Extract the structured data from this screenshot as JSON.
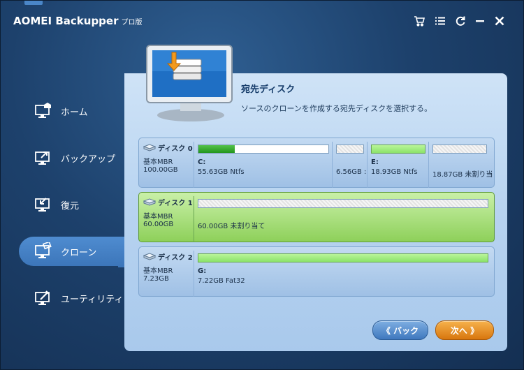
{
  "app": {
    "title": "AOMEI Backupper",
    "edition": "プロ版"
  },
  "titlebar": {
    "icons": [
      "cart-icon",
      "menu-list-icon",
      "refresh-icon",
      "minimize-icon",
      "close-icon"
    ]
  },
  "sidebar": {
    "items": [
      {
        "label": "ホーム",
        "icon": "home-icon",
        "active": false
      },
      {
        "label": "バックアップ",
        "icon": "backup-icon",
        "active": false
      },
      {
        "label": "復元",
        "icon": "restore-icon",
        "active": false
      },
      {
        "label": "クローン",
        "icon": "clone-icon",
        "active": true
      },
      {
        "label": "ユーティリティ",
        "icon": "tools-icon",
        "active": false
      }
    ]
  },
  "panel": {
    "heading": "宛先ディスク",
    "description": "ソースのクローンを作成する宛先ディスクを選択する。"
  },
  "disks": [
    {
      "name": "ディスク 0",
      "type": "基本MBR",
      "size": "100.00GB",
      "selected": false,
      "partitions": [
        {
          "label": "C:",
          "size": "55.63GB Ntfs",
          "used_fraction": 0.28,
          "style": "used"
        },
        {
          "label": "",
          "size": "6.56GB :",
          "used_fraction": 0,
          "style": "hatch"
        },
        {
          "label": "E:",
          "size": "18.93GB Ntfs",
          "used_fraction": 1.0,
          "style": "lime"
        },
        {
          "label": "",
          "size": "18.87GB 未割り当",
          "used_fraction": 0,
          "style": "hatch"
        }
      ]
    },
    {
      "name": "ディスク 1",
      "type": "基本MBR",
      "size": "60.00GB",
      "selected": true,
      "partitions": [
        {
          "label": "",
          "size": "60.00GB 未割り当て",
          "used_fraction": 0,
          "style": "hatch"
        }
      ]
    },
    {
      "name": "ディスク 2",
      "type": "基本MBR",
      "size": "7.23GB",
      "selected": false,
      "partitions": [
        {
          "label": "G:",
          "size": "7.22GB Fat32",
          "used_fraction": 1.0,
          "style": "lime"
        }
      ]
    }
  ],
  "buttons": {
    "back": "《 バック",
    "next": "次へ 》"
  },
  "colors": {
    "accent_blue": "#3c76ba",
    "selected_green": "#8ed05a",
    "next_orange": "#d8760e"
  }
}
